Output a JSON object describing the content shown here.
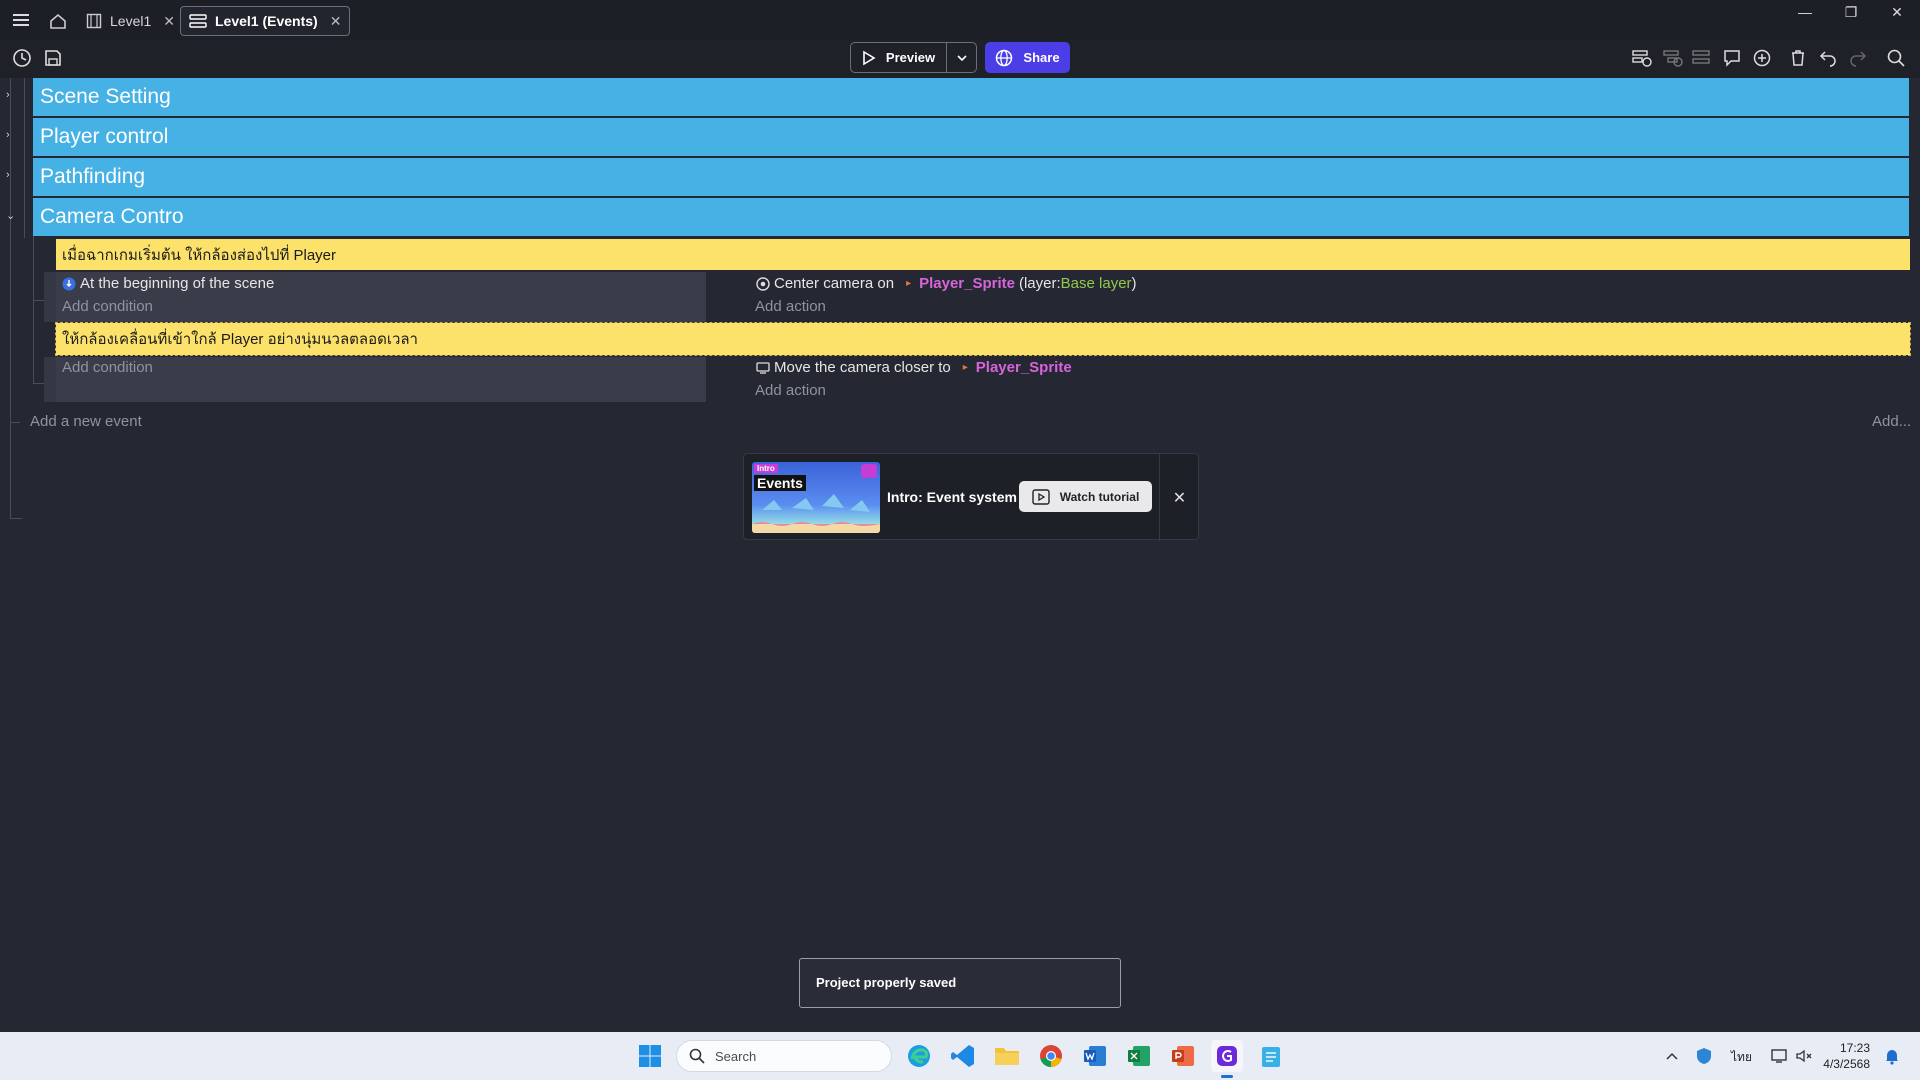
{
  "tabs": [
    {
      "label": "Level1"
    },
    {
      "label": "Level1 (Events)"
    }
  ],
  "toolbar": {
    "preview_label": "Preview",
    "share_label": "Share"
  },
  "groups": [
    {
      "label": "Scene Setting",
      "expanded": false
    },
    {
      "label": "Player control",
      "expanded": false
    },
    {
      "label": "Pathfinding",
      "expanded": false
    },
    {
      "label": "Camera Contro",
      "expanded": true
    }
  ],
  "events": {
    "comment1": "เมื่อฉากเกมเริ่มต้น ให้กล้องส่องไปที่ Player",
    "event1": {
      "condition": "At the beginning of the scene",
      "add_condition": "Add condition",
      "action_prefix": "Center camera on",
      "action_object": "Player_Sprite",
      "action_layer_open": "(layer: ",
      "action_layer": "Base layer",
      "action_layer_close": ")",
      "add_action": "Add action"
    },
    "comment2": "ให้กล้องเคลื่อนที่เข้าใกล้ Player อย่างนุ่มนวลตลอดเวลา",
    "event2": {
      "add_condition": "Add condition",
      "action_prefix": "Move the camera closer to",
      "action_object": "Player_Sprite",
      "add_action": "Add action"
    },
    "add_new_event": "Add a new event",
    "add_more": "Add..."
  },
  "tutorial": {
    "thumb_tag": "Intro",
    "thumb_title": "Events",
    "title": "Intro: Event system",
    "watch_label": "Watch tutorial"
  },
  "toast": "Project properly saved",
  "taskbar": {
    "search_placeholder": "Search",
    "language": "ไทย",
    "time": "17:23",
    "date": "4/3/2568"
  },
  "colors": {
    "group_blue": "#46b1e4",
    "comment_yellow": "#fce26a",
    "share_purple": "#4b3ee6",
    "object_pink": "#d764d9",
    "layer_green": "#93c94c"
  }
}
